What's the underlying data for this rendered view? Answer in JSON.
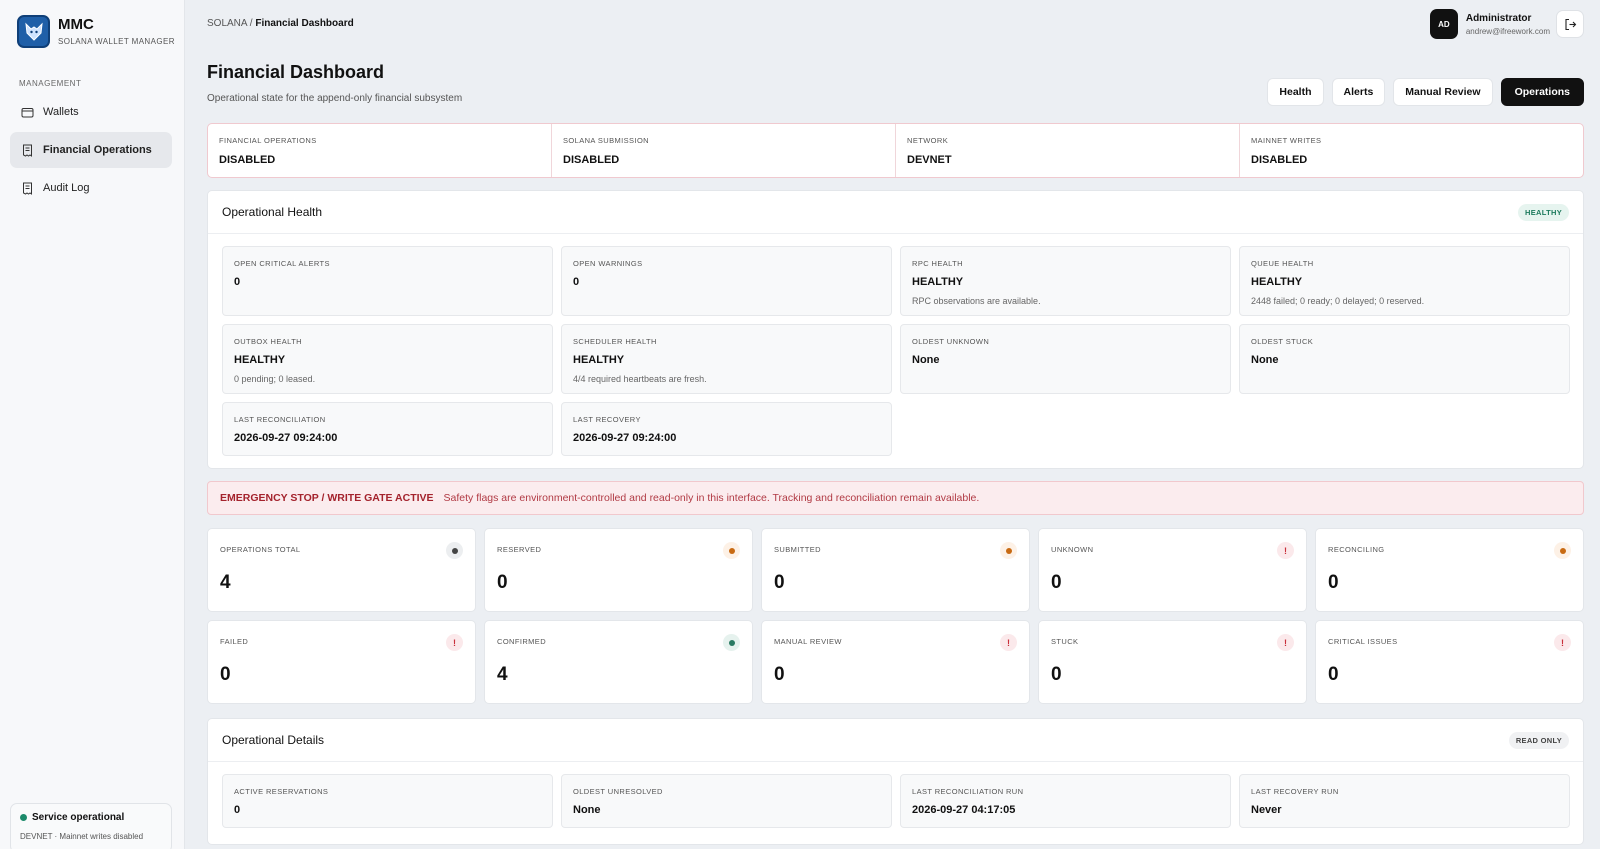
{
  "brand": {
    "name": "MMC",
    "subtitle": "SOLANA WALLET MANAGER"
  },
  "sidebar": {
    "section": "MANAGEMENT",
    "items": [
      {
        "label": "Wallets",
        "icon": "wallet-icon"
      },
      {
        "label": "Financial Operations",
        "icon": "receipt-icon",
        "active": true
      },
      {
        "label": "Audit Log",
        "icon": "log-icon"
      }
    ],
    "status": {
      "title": "Service operational",
      "detail": "DEVNET · Mainnet writes disabled"
    }
  },
  "header": {
    "breadcrumb_root": "SOLANA / ",
    "breadcrumb_current": "Financial Dashboard",
    "user": {
      "initials": "AD",
      "name": "Administrator",
      "email": "andrew@ifreework.com"
    }
  },
  "page": {
    "title": "Financial Dashboard",
    "subtitle": "Operational state for the append-only financial subsystem",
    "actions": [
      "Health",
      "Alerts",
      "Manual Review",
      "Operations"
    ]
  },
  "flags": [
    {
      "label": "FINANCIAL OPERATIONS",
      "value": "DISABLED"
    },
    {
      "label": "SOLANA SUBMISSION",
      "value": "DISABLED"
    },
    {
      "label": "NETWORK",
      "value": "DEVNET"
    },
    {
      "label": "MAINNET WRITES",
      "value": "DISABLED"
    }
  ],
  "health": {
    "title": "Operational Health",
    "badge": "HEALTHY",
    "cells": [
      {
        "label": "OPEN CRITICAL ALERTS",
        "value": "0",
        "note": ""
      },
      {
        "label": "OPEN WARNINGS",
        "value": "0",
        "note": ""
      },
      {
        "label": "RPC HEALTH",
        "value": "HEALTHY",
        "note": "RPC observations are available."
      },
      {
        "label": "QUEUE HEALTH",
        "value": "HEALTHY",
        "note": "2448 failed; 0 ready; 0 delayed; 0 reserved."
      },
      {
        "label": "OUTBOX HEALTH",
        "value": "HEALTHY",
        "note": "0 pending; 0 leased."
      },
      {
        "label": "SCHEDULER HEALTH",
        "value": "HEALTHY",
        "note": "4/4 required heartbeats are fresh."
      },
      {
        "label": "OLDEST UNKNOWN",
        "value": "None",
        "note": ""
      },
      {
        "label": "OLDEST STUCK",
        "value": "None",
        "note": ""
      },
      {
        "label": "LAST RECONCILIATION",
        "value": "2026-09-27 09:24:00",
        "note": ""
      },
      {
        "label": "LAST RECOVERY",
        "value": "2026-09-27 09:24:00",
        "note": ""
      }
    ]
  },
  "alert": {
    "title": "EMERGENCY STOP / WRITE GATE ACTIVE",
    "message": "Safety flags are environment-controlled and read-only in this interface. Tracking and reconciliation remain available."
  },
  "stats": [
    {
      "label": "OPERATIONS TOTAL",
      "value": "4",
      "indicator": "neutral"
    },
    {
      "label": "RESERVED",
      "value": "0",
      "indicator": "orange"
    },
    {
      "label": "SUBMITTED",
      "value": "0",
      "indicator": "orange"
    },
    {
      "label": "UNKNOWN",
      "value": "0",
      "indicator": "red"
    },
    {
      "label": "RECONCILING",
      "value": "0",
      "indicator": "orange"
    },
    {
      "label": "FAILED",
      "value": "0",
      "indicator": "red"
    },
    {
      "label": "CONFIRMED",
      "value": "4",
      "indicator": "green"
    },
    {
      "label": "MANUAL REVIEW",
      "value": "0",
      "indicator": "red"
    },
    {
      "label": "STUCK",
      "value": "0",
      "indicator": "red"
    },
    {
      "label": "CRITICAL ISSUES",
      "value": "0",
      "indicator": "red"
    }
  ],
  "details": {
    "title": "Operational Details",
    "badge": "READ ONLY",
    "cells": [
      {
        "label": "ACTIVE RESERVATIONS",
        "value": "0"
      },
      {
        "label": "OLDEST UNRESOLVED",
        "value": "None"
      },
      {
        "label": "LAST RECONCILIATION RUN",
        "value": "2026-09-27 04:17:05"
      },
      {
        "label": "LAST RECOVERY RUN",
        "value": "Never"
      }
    ]
  }
}
